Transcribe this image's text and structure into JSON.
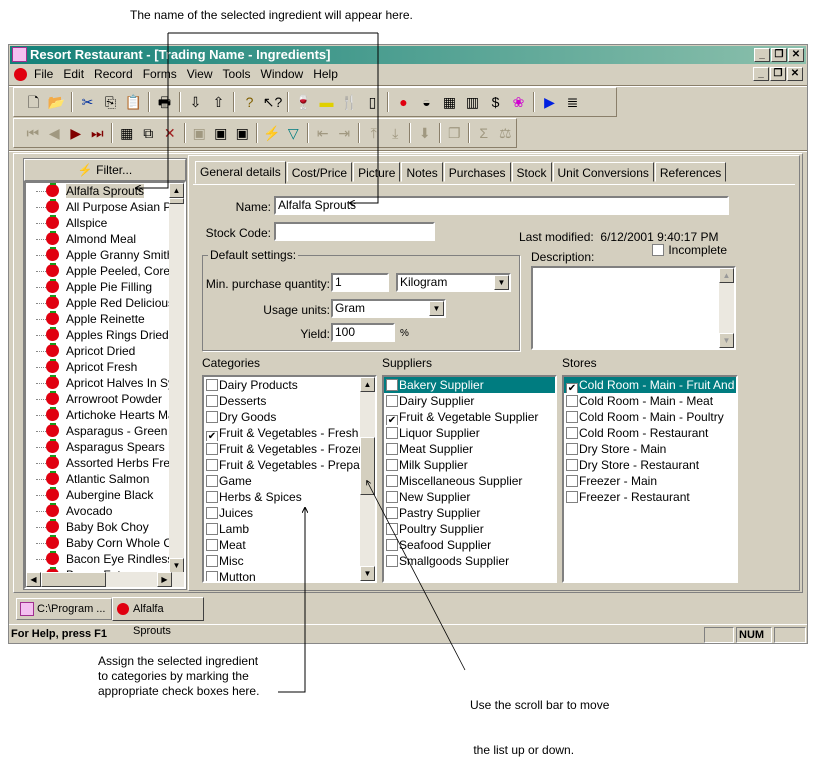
{
  "annotations": {
    "top": "The name of the selected ingredient will appear here.",
    "categories": [
      "Assign the selected ingredient",
      "to categories by marking the",
      "appropriate check boxes here."
    ],
    "scroll": [
      "Use the scroll bar to move",
      " the list up or down."
    ]
  },
  "window": {
    "title": "Resort Restaurant - [Trading Name - Ingredients]"
  },
  "menu": [
    "File",
    "Edit",
    "Record",
    "Forms",
    "View",
    "Tools",
    "Window",
    "Help"
  ],
  "filter_label": "Filter...",
  "ingredients": [
    "Alfalfa Sprouts",
    "All Purpose Asian Paste",
    "Allspice",
    "Almond Meal",
    "Apple Granny Smith",
    "Apple Peeled, Cored And Sliced",
    "Apple Pie Filling",
    "Apple Red Delicious",
    "Apple Reinette",
    "Apples Rings Dried",
    "Apricot Dried",
    "Apricot Fresh",
    "Apricot Halves In Syrup",
    "Arrowroot Powder",
    "Artichoke Hearts Marinated",
    "Asparagus - Green Fresh",
    "Asparagus Spears Frozen",
    "Assorted Herbs Fresh",
    "Atlantic Salmon",
    "Aubergine Black",
    "Avocado",
    "Baby Bok Choy",
    "Baby Corn Whole Canned",
    "Bacon Eye Rindless",
    "Bacon Fat"
  ],
  "tabs": [
    "General details",
    "Cost/Price",
    "Picture",
    "Notes",
    "Purchases",
    "Stock",
    "Unit Conversions",
    "References"
  ],
  "form": {
    "name_label": "Name:",
    "name_value": "Alfalfa Sprouts",
    "stock_code_label": "Stock Code:",
    "stock_code_value": "",
    "last_modified_label": "Last modified:",
    "last_modified_value": "6/12/2001 9:40:17 PM",
    "incomplete_label": "Incomplete",
    "description_label": "Description:",
    "default_settings_label": "Default settings:",
    "min_qty_label": "Min. purchase quantity:",
    "min_qty_value": "1",
    "min_qty_unit": "Kilogram",
    "usage_units_label": "Usage units:",
    "usage_units_value": "Gram",
    "yield_label": "Yield:",
    "yield_value": "100",
    "yield_unit": "%"
  },
  "categories": {
    "label": "Categories",
    "items": [
      {
        "t": "Dairy Products",
        "c": false
      },
      {
        "t": "Desserts",
        "c": false
      },
      {
        "t": "Dry Goods",
        "c": false
      },
      {
        "t": "Fruit & Vegetables - Fresh",
        "c": true
      },
      {
        "t": "Fruit & Vegetables - Frozen",
        "c": false
      },
      {
        "t": "Fruit & Vegetables - Prepared",
        "c": false
      },
      {
        "t": "Game",
        "c": false
      },
      {
        "t": "Herbs & Spices",
        "c": false
      },
      {
        "t": "Juices",
        "c": false
      },
      {
        "t": "Lamb",
        "c": false
      },
      {
        "t": "Meat",
        "c": false
      },
      {
        "t": "Misc",
        "c": false
      },
      {
        "t": "Mutton",
        "c": false
      }
    ]
  },
  "suppliers": {
    "label": "Suppliers",
    "items": [
      {
        "t": "Bakery Supplier",
        "c": false
      },
      {
        "t": "Dairy Supplier",
        "c": false
      },
      {
        "t": "Fruit & Vegetable Supplier",
        "c": true
      },
      {
        "t": "Liquor Supplier",
        "c": false
      },
      {
        "t": "Meat Supplier",
        "c": false
      },
      {
        "t": "Milk Supplier",
        "c": false
      },
      {
        "t": "Miscellaneous Supplier",
        "c": false
      },
      {
        "t": "New Supplier",
        "c": false
      },
      {
        "t": "Pastry Supplier",
        "c": false
      },
      {
        "t": "Poultry Supplier",
        "c": false
      },
      {
        "t": "Seafood Supplier",
        "c": false
      },
      {
        "t": "Smallgoods Supplier",
        "c": false
      }
    ]
  },
  "stores": {
    "label": "Stores",
    "items": [
      {
        "t": "Cold Room - Main - Fruit And Veg",
        "c": true
      },
      {
        "t": "Cold Room - Main - Meat",
        "c": false
      },
      {
        "t": "Cold Room - Main - Poultry",
        "c": false
      },
      {
        "t": "Cold Room - Restaurant",
        "c": false
      },
      {
        "t": "Dry Store - Main",
        "c": false
      },
      {
        "t": "Dry Store - Restaurant",
        "c": false
      },
      {
        "t": "Freezer - Main",
        "c": false
      },
      {
        "t": "Freezer - Restaurant",
        "c": false
      }
    ]
  },
  "task_tabs": [
    "C:\\Program ...",
    "Alfalfa Sprouts"
  ],
  "status": {
    "help": "For Help, press F1",
    "num": "NUM"
  },
  "colors": {
    "selection": "#007c80",
    "title_start": "#138078",
    "title_end": "#8cc0ac"
  },
  "toolbar1": [
    "new-icon",
    "open-icon",
    "cut-icon",
    "copy-icon",
    "paste-icon",
    "print-icon",
    "move-down-icon",
    "move-up-icon",
    "help-icon",
    "context-help-icon",
    "recipe-icon",
    "cheese-icon",
    "cutlery-icon",
    "measure-icon",
    "ingredient-icon",
    "pot-icon",
    "menu-table-icon",
    "book-icon",
    "price-table-icon",
    "balloons-icon",
    "truck-icon",
    "report-icon"
  ],
  "toolbar2": [
    "first-record-icon",
    "prev-record-icon",
    "next-record-icon",
    "last-record-icon",
    "new-record-icon",
    "duplicate-record-icon",
    "delete-record-icon",
    "save-icon",
    "save-undo-icon",
    "save-close-icon",
    "filter-lightning-icon",
    "filter-icon",
    "indent-left-icon",
    "indent-right-icon",
    "move-up-level-icon",
    "move-down-level-icon",
    "import-icon",
    "window-icon",
    "sum-icon",
    "scale-icon"
  ]
}
